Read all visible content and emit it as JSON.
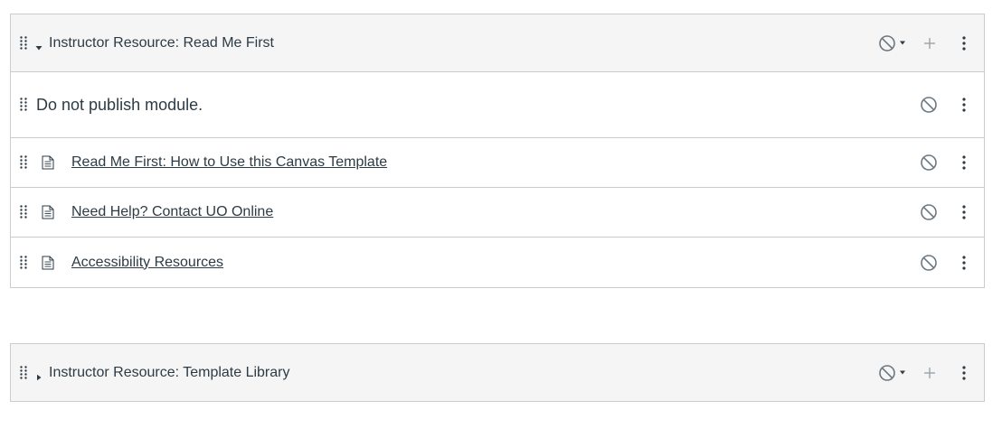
{
  "modules": [
    {
      "title": "Instructor Resource: Read Me First",
      "expanded": true,
      "items": [
        {
          "type": "subheader",
          "title": "Do not publish module."
        },
        {
          "type": "page",
          "title": "Read Me First: How to Use this Canvas Template"
        },
        {
          "type": "page",
          "title": "Need Help? Contact UO Online"
        },
        {
          "type": "page",
          "title": "Accessibility Resources"
        }
      ]
    },
    {
      "title": "Instructor Resource: Template Library",
      "expanded": false,
      "items": []
    }
  ],
  "icons": {
    "drag": "drag-handle-icon",
    "collapse": "caret-down-icon",
    "expand": "caret-right-icon",
    "unpublished": "unpublished-icon",
    "add": "plus-icon",
    "more": "kebab-icon",
    "page": "page-document-icon"
  },
  "colors": {
    "text": "#2d3b45",
    "header_bg": "#f5f5f5",
    "border": "#c7cdd1",
    "icon": "#6b7780"
  }
}
